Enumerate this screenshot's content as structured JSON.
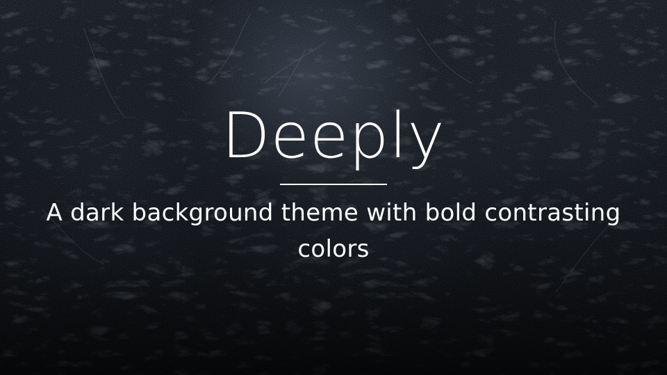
{
  "slide": {
    "title": "Deeply",
    "subtitle": "A dark background theme with bold contrasting colors",
    "background_image": "dark snowy forest"
  },
  "colors": {
    "text": "#ffffff",
    "background": "#0a0d13"
  }
}
